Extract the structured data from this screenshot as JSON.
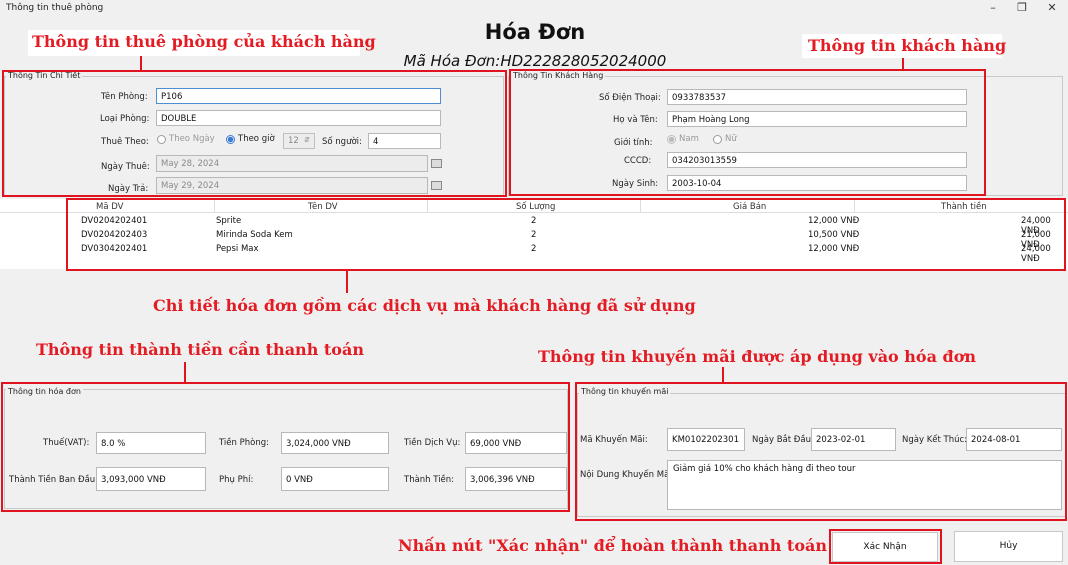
{
  "window": {
    "title": "Thông tin thuê phòng",
    "min_icon": "minimize-icon",
    "max_icon": "maximize-icon",
    "close_icon": "close-icon"
  },
  "header": {
    "title": "Hóa Đơn",
    "invoice_code": "Mã Hóa Đơn:HD222828052024000"
  },
  "annotations": {
    "room_info": "Thông tin thuê phòng của khách hàng",
    "customer_info": "Thông tin khách hàng",
    "invoice_detail": "Chi tiết hóa đơn gồm các dịch vụ mà khách hàng đã sử dụng",
    "payment_info": "Thông tin thành tiền cần thanh toán",
    "promo_info": "Thông tin khuyến mãi được áp dụng vào hóa đơn",
    "confirm_hint": "Nhấn nút \"Xác nhận\" để hoàn thành thanh toán"
  },
  "room": {
    "group_label": "Thông Tin Chi Tiết",
    "room_name_label": "Tên Phòng:",
    "room_name": "P106",
    "room_type_label": "Loại Phòng:",
    "room_type": "DOUBLE",
    "rent_by_label": "Thuê Theo:",
    "by_day": "Theo Ngày",
    "by_hour": "Theo giờ",
    "hours": "12",
    "people_label": "Số người:",
    "people": "4",
    "check_in_label": "Ngày Thuê:",
    "check_in": "May 28, 2024",
    "check_out_label": "Ngày Trả:",
    "check_out": "May 29, 2024"
  },
  "customer": {
    "group_label": "Thông Tin Khách Hàng",
    "phone_label": "Số Điện Thoại:",
    "phone": "0933783537",
    "name_label": "Họ và Tên:",
    "name": "Phạm Hoàng Long",
    "gender_label": "Giới tính:",
    "male": "Nam",
    "female": "Nữ",
    "id_label": "CCCD:",
    "id": "034203013559",
    "dob_label": "Ngày Sinh:",
    "dob": "2003-10-04"
  },
  "services": {
    "headers": [
      "Mã DV",
      "Tên DV",
      "Số Lượng",
      "Giá Bán",
      "Thành tiền"
    ],
    "rows": [
      [
        "DV0204202401",
        "Sprite",
        "2",
        "12,000 VNĐ",
        "24,000 VNĐ"
      ],
      [
        "DV0204202403",
        "Mirinda Soda Kem",
        "2",
        "10,500 VNĐ",
        "21,000 VNĐ"
      ],
      [
        "DV0304202401",
        "Pepsi Max",
        "2",
        "12,000 VNĐ",
        "24,000 VNĐ"
      ]
    ]
  },
  "invoice": {
    "group_label": "Thông tin hóa đơn",
    "vat_label": "Thuế(VAT):",
    "vat": "8.0 %",
    "room_fee_label": "Tiền Phòng:",
    "room_fee": "3,024,000 VNĐ",
    "service_fee_label": "Tiền Dịch Vụ:",
    "service_fee": "69,000 VNĐ",
    "initial_total_label": "Thành Tiền Ban Đầu:",
    "initial_total": "3,093,000 VNĐ",
    "surcharge_label": "Phụ Phí:",
    "surcharge": "0 VNĐ",
    "total_label": "Thành Tiền:",
    "total": "3,006,396 VNĐ"
  },
  "promo": {
    "group_label": "Thông tin khuyến mãi",
    "code_label": "Mã Khuyến Mãi:",
    "code": "KM0102202301",
    "start_label": "Ngày Bắt Đầu:",
    "start": "2023-02-01",
    "end_label": "Ngày Kết Thúc:",
    "end": "2024-08-01",
    "content_label": "Nội Dung Khuyến Mãi:",
    "content": "Giảm giá 10% cho khách hàng đi theo tour"
  },
  "buttons": {
    "confirm": "Xác Nhận",
    "cancel": "Hủy"
  }
}
